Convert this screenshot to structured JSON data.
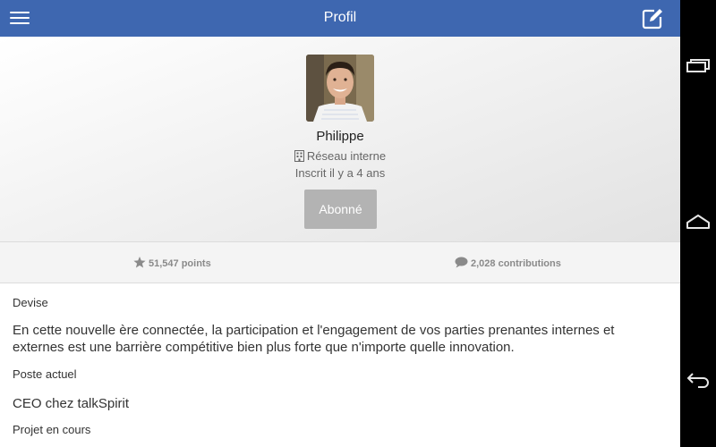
{
  "header": {
    "title": "Profil"
  },
  "profile": {
    "name": "Philippe",
    "network": "Réseau interne",
    "member_since": "Inscrit il y a 4 ans",
    "follow_label": "Abonné"
  },
  "stats": {
    "points": "51,547 points",
    "contributions": "2,028 contributions"
  },
  "sections": {
    "devise_label": "Devise",
    "devise_text": "En cette nouvelle ère connectée, la participation et l'engagement de vos parties prenantes internes et externes est une barrière compétitive bien plus forte que n'importe quelle innovation.",
    "poste_label": "Poste actuel",
    "poste_text": "CEO chez talkSpirit",
    "projet_label": "Projet en cours"
  },
  "colors": {
    "topbar": "#3e67b0",
    "follow_button": "#b3b3b3"
  },
  "icons": [
    "menu-icon",
    "edit-icon",
    "building-icon",
    "star-icon",
    "comment-icon",
    "recent-apps-icon",
    "home-icon",
    "back-icon"
  ]
}
